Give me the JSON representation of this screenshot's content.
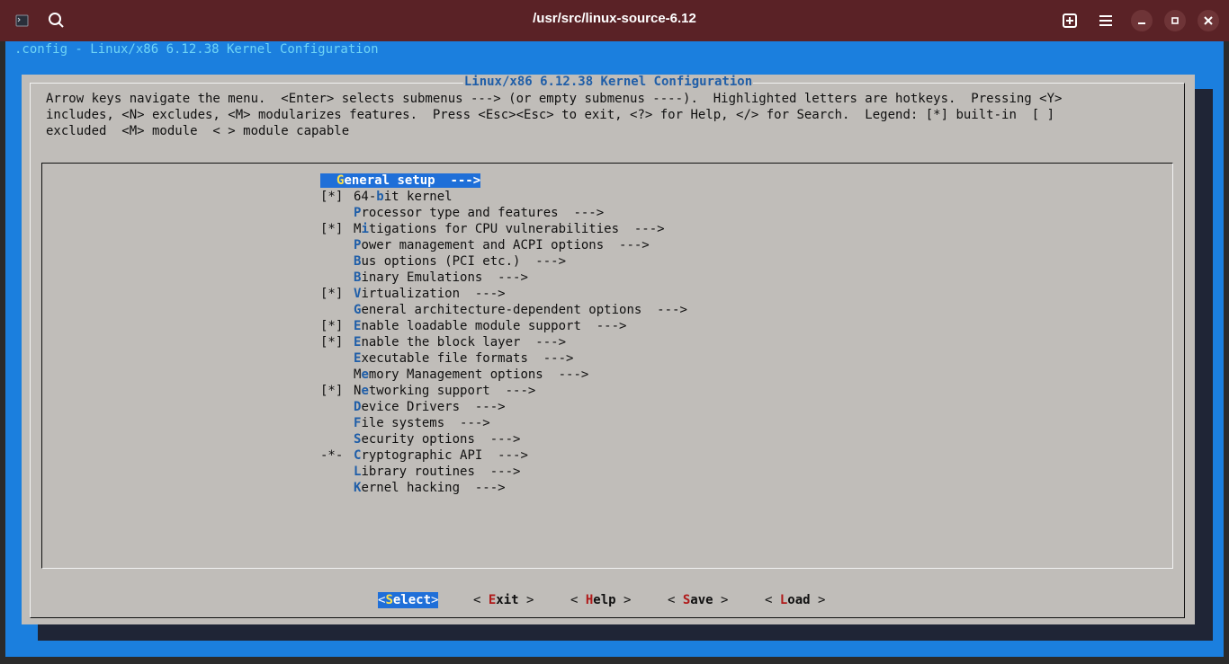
{
  "titlebar": {
    "path": "/usr/src/linux-source-6.12",
    "icons": [
      "terminal-icon",
      "search-icon",
      "new-tab-icon",
      "menu-icon",
      "minimize-icon",
      "maximize-icon",
      "close-icon"
    ]
  },
  "terminal": {
    "header": ".config - Linux/x86 6.12.38 Kernel Configuration"
  },
  "dialog": {
    "title": "Linux/x86 6.12.38 Kernel Configuration",
    "help_lines": [
      "Arrow keys navigate the menu.  <Enter> selects submenus ---> (or empty submenus ----).  Highlighted letters are hotkeys.  Pressing <Y>",
      "includes, <N> excludes, <M> modularizes features.  Press <Esc><Esc> to exit, <?> for Help, </> for Search.  Legend: [*] built-in  [ ]",
      "excluded  <M> module  < > module capable"
    ]
  },
  "menu": {
    "items": [
      {
        "prefix": "",
        "before": "",
        "hotkey": "G",
        "after": "eneral setup  --->",
        "selected": true
      },
      {
        "prefix": "[*]",
        "before": "64-",
        "hotkey": "b",
        "after": "it kernel"
      },
      {
        "prefix": "",
        "before": "",
        "hotkey": "P",
        "after": "rocessor type and features  --->"
      },
      {
        "prefix": "[*]",
        "before": "M",
        "hotkey": "i",
        "after": "tigations for CPU vulnerabilities  --->"
      },
      {
        "prefix": "",
        "before": "",
        "hotkey": "P",
        "after": "ower management and ACPI options  --->"
      },
      {
        "prefix": "",
        "before": "",
        "hotkey": "B",
        "after": "us options (PCI etc.)  --->"
      },
      {
        "prefix": "",
        "before": "",
        "hotkey": "B",
        "after": "inary Emulations  --->"
      },
      {
        "prefix": "[*]",
        "before": "",
        "hotkey": "V",
        "after": "irtualization  --->"
      },
      {
        "prefix": "",
        "before": "",
        "hotkey": "G",
        "after": "eneral architecture-dependent options  --->"
      },
      {
        "prefix": "[*]",
        "before": "",
        "hotkey": "E",
        "after": "nable loadable module support  --->"
      },
      {
        "prefix": "[*]",
        "before": "",
        "hotkey": "E",
        "after": "nable the block layer  --->"
      },
      {
        "prefix": "",
        "before": "",
        "hotkey": "E",
        "after": "xecutable file formats  --->"
      },
      {
        "prefix": "",
        "before": "M",
        "hotkey": "e",
        "after": "mory Management options  --->"
      },
      {
        "prefix": "[*]",
        "before": "N",
        "hotkey": "e",
        "after": "tworking support  --->"
      },
      {
        "prefix": "",
        "before": "",
        "hotkey": "D",
        "after": "evice Drivers  --->"
      },
      {
        "prefix": "",
        "before": "",
        "hotkey": "F",
        "after": "ile systems  --->"
      },
      {
        "prefix": "",
        "before": "",
        "hotkey": "S",
        "after": "ecurity options  --->"
      },
      {
        "prefix": "-*-",
        "before": "",
        "hotkey": "C",
        "after": "ryptographic API  --->"
      },
      {
        "prefix": "",
        "before": "",
        "hotkey": "L",
        "after": "ibrary routines  --->"
      },
      {
        "prefix": "",
        "before": "",
        "hotkey": "K",
        "after": "ernel hacking  --->"
      }
    ]
  },
  "buttons": [
    {
      "open": "<",
      "hotkey": "S",
      "rest": "elect",
      "close": ">",
      "active": true
    },
    {
      "open": "< ",
      "hotkey": "E",
      "rest": "xit",
      "close": " >"
    },
    {
      "open": "< ",
      "hotkey": "H",
      "rest": "elp",
      "close": " >"
    },
    {
      "open": "< ",
      "hotkey": "S",
      "rest": "ave",
      "close": " >"
    },
    {
      "open": "< ",
      "hotkey": "L",
      "rest": "oad",
      "close": " >"
    }
  ]
}
